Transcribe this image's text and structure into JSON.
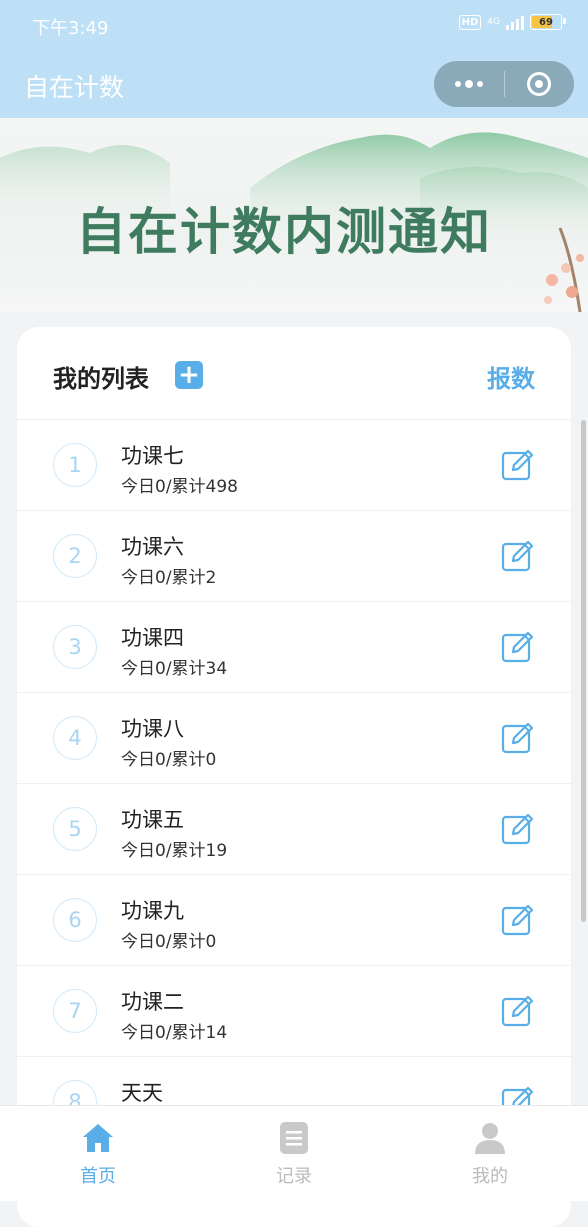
{
  "status_bar": {
    "time": "下午3:49",
    "hd": "HD",
    "network": "4G",
    "battery_level": "69"
  },
  "app": {
    "title": "自在计数"
  },
  "banner": {
    "text": "自在计数内测通知"
  },
  "list_card": {
    "title": "我的列表",
    "add_label": "+",
    "report_label": "报数",
    "items": [
      {
        "index": "1",
        "name": "功课七",
        "stats": "今日0/累计498"
      },
      {
        "index": "2",
        "name": "功课六",
        "stats": "今日0/累计2"
      },
      {
        "index": "3",
        "name": "功课四",
        "stats": "今日0/累计34"
      },
      {
        "index": "4",
        "name": "功课八",
        "stats": "今日0/累计0"
      },
      {
        "index": "5",
        "name": "功课五",
        "stats": "今日0/累计19"
      },
      {
        "index": "6",
        "name": "功课九",
        "stats": "今日0/累计0"
      },
      {
        "index": "7",
        "name": "功课二",
        "stats": "今日0/累计14"
      },
      {
        "index": "8",
        "name": "天天",
        "stats": ""
      }
    ]
  },
  "tabbar": {
    "tabs": [
      {
        "label": "首页",
        "icon": "home-icon",
        "active": true
      },
      {
        "label": "记录",
        "icon": "list-icon",
        "active": false
      },
      {
        "label": "我的",
        "icon": "user-icon",
        "active": false
      }
    ]
  },
  "colors": {
    "header_bg": "#bde0f7",
    "accent": "#5aaee8",
    "index_circle": "#a9d5f2"
  }
}
